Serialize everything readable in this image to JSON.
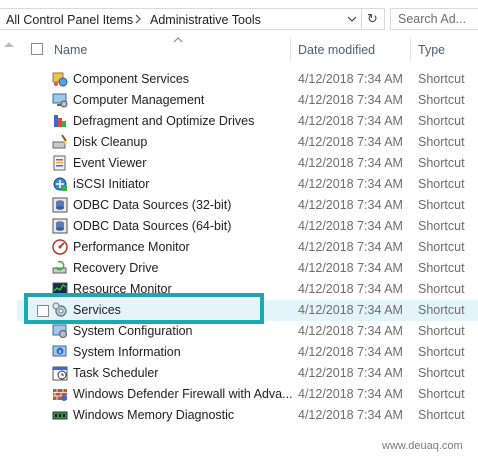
{
  "address_bar": {
    "breadcrumb": [
      "All Control Panel Items",
      "Administrative Tools"
    ],
    "separator_icon": "chevron-right-icon",
    "dropdown_icon": "chevron-down-icon",
    "refresh_icon": "refresh-icon",
    "refresh_glyph": "↻"
  },
  "search": {
    "placeholder": "Search Ad..."
  },
  "columns": {
    "name": "Name",
    "date_modified": "Date modified",
    "type": "Type"
  },
  "highlight_color": "#19a9b0",
  "selection_color": "#e5f3fb",
  "items": [
    {
      "name": "Component Services",
      "date": "4/12/2018 7:34 AM",
      "type": "Shortcut",
      "icon": "component-services-icon"
    },
    {
      "name": "Computer Management",
      "date": "4/12/2018 7:34 AM",
      "type": "Shortcut",
      "icon": "computer-management-icon"
    },
    {
      "name": "Defragment and Optimize Drives",
      "date": "4/12/2018 7:34 AM",
      "type": "Shortcut",
      "icon": "defragment-icon"
    },
    {
      "name": "Disk Cleanup",
      "date": "4/12/2018 7:34 AM",
      "type": "Shortcut",
      "icon": "disk-cleanup-icon"
    },
    {
      "name": "Event Viewer",
      "date": "4/12/2018 7:34 AM",
      "type": "Shortcut",
      "icon": "event-viewer-icon"
    },
    {
      "name": "iSCSI Initiator",
      "date": "4/12/2018 7:34 AM",
      "type": "Shortcut",
      "icon": "iscsi-icon"
    },
    {
      "name": "ODBC Data Sources (32-bit)",
      "date": "4/12/2018 7:34 AM",
      "type": "Shortcut",
      "icon": "odbc-icon"
    },
    {
      "name": "ODBC Data Sources (64-bit)",
      "date": "4/12/2018 7:34 AM",
      "type": "Shortcut",
      "icon": "odbc-icon"
    },
    {
      "name": "Performance Monitor",
      "date": "4/12/2018 7:34 AM",
      "type": "Shortcut",
      "icon": "performance-monitor-icon"
    },
    {
      "name": "Recovery Drive",
      "date": "4/12/2018 7:34 AM",
      "type": "Shortcut",
      "icon": "recovery-drive-icon"
    },
    {
      "name": "Resource Monitor",
      "date": "4/12/2018 7:34 AM",
      "type": "Shortcut",
      "icon": "resource-monitor-icon"
    },
    {
      "name": "Services",
      "date": "4/12/2018 7:34 AM",
      "type": "Shortcut",
      "icon": "services-gear-icon",
      "selected": true
    },
    {
      "name": "System Configuration",
      "date": "4/12/2018 7:34 AM",
      "type": "Shortcut",
      "icon": "system-configuration-icon"
    },
    {
      "name": "System Information",
      "date": "4/12/2018 7:34 AM",
      "type": "Shortcut",
      "icon": "system-information-icon"
    },
    {
      "name": "Task Scheduler",
      "date": "4/12/2018 7:34 AM",
      "type": "Shortcut",
      "icon": "task-scheduler-icon"
    },
    {
      "name": "Windows Defender Firewall with Adva...",
      "date": "4/12/2018 7:34 AM",
      "type": "Shortcut",
      "icon": "firewall-icon"
    },
    {
      "name": "Windows Memory Diagnostic",
      "date": "4/12/2018 7:34 AM",
      "type": "Shortcut",
      "icon": "memory-diagnostic-icon"
    }
  ],
  "watermark": "www.deuaq.com"
}
